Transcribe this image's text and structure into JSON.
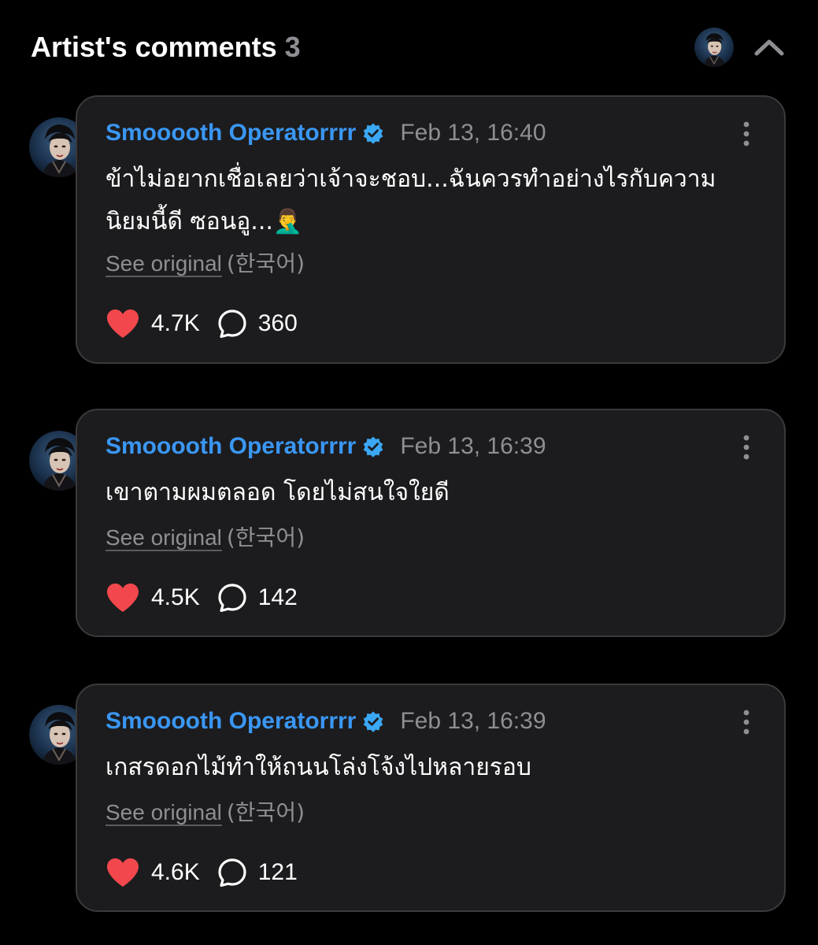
{
  "header": {
    "title": "Artist's comments",
    "count": "3",
    "avatar_icon": "artist-avatar",
    "collapse_icon": "chevron-up-icon"
  },
  "colors": {
    "background": "#000000",
    "card_background": "#1c1c1e",
    "card_border": "#3a3a3c",
    "author_blue": "#3a97f4",
    "verified_badge": "#3aa8f5",
    "muted_text": "#8e8e93",
    "heart_red": "#f2484d"
  },
  "comments": [
    {
      "author": "Smooooth Operatorrrr",
      "verified_icon": "verified-badge-icon",
      "timestamp": "Feb 13, 16:40",
      "body": "ข้าไม่อยากเชื่อเลยว่าเจ้าจะชอบ...ฉันควรทำอย่างไรกับความนิยมนี้ดี ซอนอู...🤦‍♂",
      "see_original": "See original",
      "language": "(한국어)",
      "likes": "4.7K",
      "replies": "360"
    },
    {
      "author": "Smooooth Operatorrrr",
      "verified_icon": "verified-badge-icon",
      "timestamp": "Feb 13, 16:39",
      "body": "เขาตามผมตลอด โดยไม่สนใจใยดี",
      "see_original": "See original",
      "language": "(한국어)",
      "likes": "4.5K",
      "replies": "142"
    },
    {
      "author": "Smooooth Operatorrrr",
      "verified_icon": "verified-badge-icon",
      "timestamp": "Feb 13, 16:39",
      "body": "เกสรดอกไม้ทำให้ถนนโล่งโจ้งไปหลายรอบ",
      "see_original": "See original",
      "language": "(한국어)",
      "likes": "4.6K",
      "replies": "121"
    }
  ]
}
